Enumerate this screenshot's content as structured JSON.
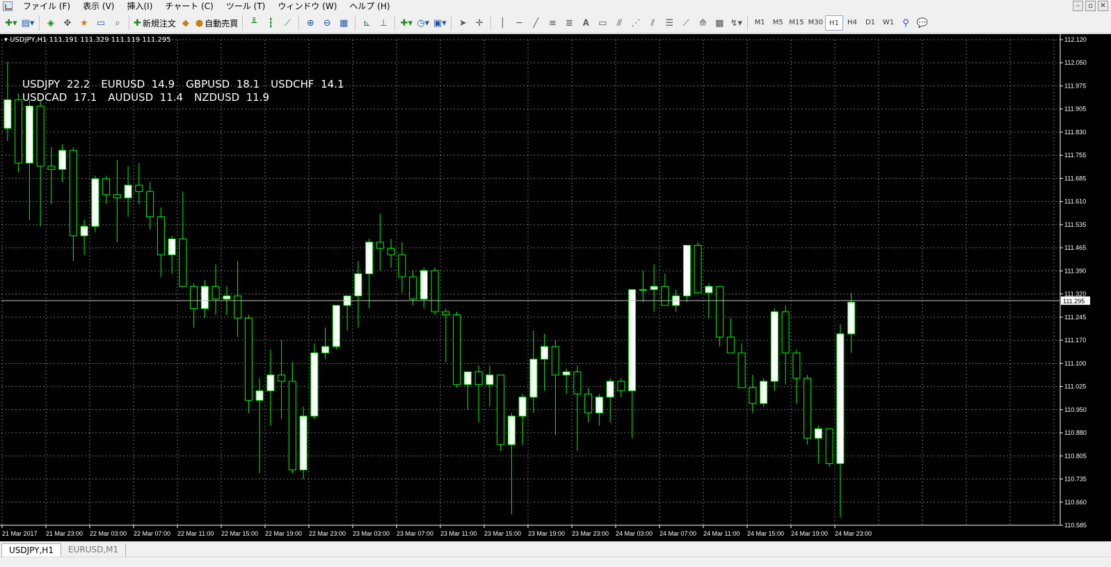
{
  "menubar": {
    "items": [
      "ファイル (F)",
      "表示 (V)",
      "挿入(I)",
      "チャート (C)",
      "ツール (T)",
      "ウィンドウ (W)",
      "ヘルプ (H)"
    ],
    "window_controls": [
      "–",
      "▫",
      "✕"
    ]
  },
  "toolbar": {
    "new_order_label": "新規注文",
    "auto_trade_label": "自動売買",
    "timeframes": [
      "M1",
      "M5",
      "M15",
      "M30",
      "H1",
      "H4",
      "D1",
      "W1"
    ],
    "active_timeframe": "H1"
  },
  "chart": {
    "title": "USDJPY,H1  111.191 111.329 111.119 111.295",
    "current_price_label": "111.295",
    "spreads": [
      [
        {
          "text": "USDJPY  22.2"
        },
        {
          "text": "EURUSD  14.9"
        },
        {
          "text": "GBPUSD  18.1"
        },
        {
          "text": "USDCHF  14.1"
        }
      ],
      [
        {
          "text": "USDCAD  17.1"
        },
        {
          "text": "AUDUSD  11.4"
        },
        {
          "text": "NZDUSD  11.9"
        }
      ]
    ],
    "colors": {
      "background": "#000000",
      "candle": "#00ff00",
      "bull_fill": "#ffffff",
      "bear_fill": "#000000",
      "grid": "#a0a0a0",
      "price_line": "#c0c0c0"
    }
  },
  "tabs": [
    {
      "label": "USDJPY,H1",
      "active": true
    },
    {
      "label": "EURUSD,M1",
      "active": false
    }
  ],
  "chart_data": {
    "type": "candlestick",
    "symbol": "USDJPY",
    "timeframe": "H1",
    "ylim": [
      110.585,
      112.12
    ],
    "current_price": 111.295,
    "y_ticks": [
      "112.120",
      "112.050",
      "111.975",
      "111.905",
      "111.830",
      "111.755",
      "111.685",
      "111.610",
      "111.535",
      "111.465",
      "111.390",
      "111.320",
      "111.245",
      "111.170",
      "111.100",
      "111.025",
      "110.950",
      "110.880",
      "110.805",
      "110.735",
      "110.660",
      "110.585"
    ],
    "x_ticks": [
      "21 Mar 2017",
      "21 Mar 23:00",
      "22 Mar 03:00",
      "22 Mar 07:00",
      "22 Mar 11:00",
      "22 Mar 15:00",
      "22 Mar 19:00",
      "22 Mar 23:00",
      "23 Mar 03:00",
      "23 Mar 07:00",
      "23 Mar 11:00",
      "23 Mar 15:00",
      "23 Mar 19:00",
      "23 Mar 23:00",
      "24 Mar 03:00",
      "24 Mar 07:00",
      "24 Mar 11:00",
      "24 Mar 15:00",
      "24 Mar 19:00",
      "24 Mar 23:00"
    ],
    "candles": [
      [
        111.84,
        112.05,
        111.8,
        111.93
      ],
      [
        111.93,
        111.95,
        111.7,
        111.73
      ],
      [
        111.73,
        111.93,
        111.55,
        111.91
      ],
      [
        111.91,
        111.93,
        111.53,
        111.72
      ],
      [
        111.72,
        111.78,
        111.6,
        111.71
      ],
      [
        111.71,
        111.79,
        111.67,
        111.77
      ],
      [
        111.77,
        111.78,
        111.42,
        111.5
      ],
      [
        111.5,
        111.55,
        111.44,
        111.53
      ],
      [
        111.53,
        111.69,
        111.51,
        111.68
      ],
      [
        111.68,
        111.69,
        111.6,
        111.63
      ],
      [
        111.63,
        111.74,
        111.48,
        111.62
      ],
      [
        111.62,
        111.72,
        111.56,
        111.66
      ],
      [
        111.66,
        111.73,
        111.6,
        111.64
      ],
      [
        111.64,
        111.67,
        111.52,
        111.56
      ],
      [
        111.56,
        111.59,
        111.37,
        111.44
      ],
      [
        111.44,
        111.5,
        111.38,
        111.49
      ],
      [
        111.49,
        111.64,
        111.37,
        111.34
      ],
      [
        111.34,
        111.35,
        111.21,
        111.27
      ],
      [
        111.27,
        111.36,
        111.24,
        111.34
      ],
      [
        111.34,
        111.41,
        111.25,
        111.3
      ],
      [
        111.3,
        111.34,
        111.25,
        111.31
      ],
      [
        111.31,
        111.42,
        111.18,
        111.24
      ],
      [
        111.24,
        111.25,
        110.94,
        110.98
      ],
      [
        110.98,
        111.05,
        110.75,
        111.01
      ],
      [
        111.01,
        111.14,
        110.9,
        111.06
      ],
      [
        111.06,
        111.17,
        110.92,
        111.04
      ],
      [
        111.04,
        111.1,
        110.75,
        110.76
      ],
      [
        110.76,
        110.96,
        110.73,
        110.93
      ],
      [
        110.93,
        111.16,
        110.92,
        111.13
      ],
      [
        111.13,
        111.21,
        111.11,
        111.15
      ],
      [
        111.15,
        111.28,
        111.14,
        111.28
      ],
      [
        111.28,
        111.3,
        111.2,
        111.31
      ],
      [
        111.31,
        111.42,
        111.21,
        111.38
      ],
      [
        111.38,
        111.49,
        111.27,
        111.48
      ],
      [
        111.48,
        111.57,
        111.39,
        111.46
      ],
      [
        111.46,
        111.49,
        111.4,
        111.44
      ],
      [
        111.44,
        111.48,
        111.32,
        111.37
      ],
      [
        111.37,
        111.39,
        111.28,
        111.3
      ],
      [
        111.3,
        111.4,
        111.27,
        111.39
      ],
      [
        111.39,
        111.4,
        111.25,
        111.26
      ],
      [
        111.26,
        111.27,
        111.1,
        111.25
      ],
      [
        111.25,
        111.26,
        111.02,
        111.03
      ],
      [
        111.03,
        111.07,
        110.95,
        111.07
      ],
      [
        111.07,
        111.09,
        110.91,
        111.03
      ],
      [
        111.03,
        111.09,
        110.96,
        111.06
      ],
      [
        111.06,
        111.06,
        110.82,
        110.84
      ],
      [
        110.84,
        110.94,
        110.62,
        110.93
      ],
      [
        110.93,
        111.0,
        110.84,
        110.99
      ],
      [
        110.99,
        111.2,
        110.94,
        111.11
      ],
      [
        111.11,
        111.19,
        111.01,
        111.15
      ],
      [
        111.15,
        111.17,
        110.87,
        111.06
      ],
      [
        111.06,
        111.08,
        111.0,
        111.07
      ],
      [
        111.07,
        111.09,
        110.82,
        111.0
      ],
      [
        111.0,
        111.02,
        110.91,
        110.94
      ],
      [
        110.94,
        111.0,
        110.9,
        110.99
      ],
      [
        110.99,
        111.05,
        110.91,
        111.04
      ],
      [
        111.04,
        111.05,
        110.99,
        111.01
      ],
      [
        111.01,
        111.33,
        110.86,
        111.33
      ],
      [
        111.33,
        111.39,
        111.29,
        111.33
      ],
      [
        111.33,
        111.41,
        111.26,
        111.34
      ],
      [
        111.34,
        111.38,
        111.29,
        111.28
      ],
      [
        111.28,
        111.33,
        111.26,
        111.31
      ],
      [
        111.31,
        111.47,
        111.29,
        111.47
      ],
      [
        111.47,
        111.48,
        111.32,
        111.32
      ],
      [
        111.32,
        111.35,
        111.24,
        111.34
      ],
      [
        111.34,
        111.34,
        111.15,
        111.18
      ],
      [
        111.18,
        111.24,
        111.13,
        111.13
      ],
      [
        111.13,
        111.16,
        111.02,
        111.02
      ],
      [
        111.02,
        111.06,
        110.94,
        110.97
      ],
      [
        110.97,
        111.05,
        110.96,
        111.04
      ],
      [
        111.04,
        111.27,
        111.01,
        111.26
      ],
      [
        111.26,
        111.28,
        111.03,
        111.13
      ],
      [
        111.13,
        111.14,
        110.97,
        111.05
      ],
      [
        111.05,
        111.06,
        110.84,
        110.86
      ],
      [
        110.86,
        110.9,
        110.78,
        110.89
      ],
      [
        110.89,
        110.89,
        110.77,
        110.78
      ],
      [
        110.78,
        111.22,
        110.61,
        111.19
      ],
      [
        111.19,
        111.32,
        111.13,
        111.29
      ]
    ]
  }
}
